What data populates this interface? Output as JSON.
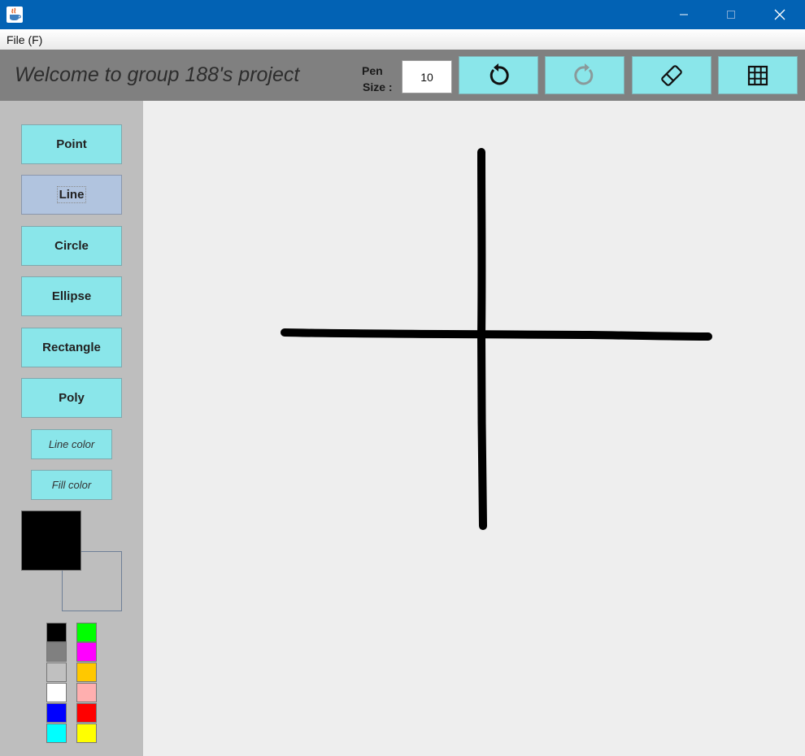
{
  "menu": {
    "file_label": "File (F)"
  },
  "toolbar": {
    "welcome_text": "Welcome to group 188's project",
    "pen_label_line1": "Pen",
    "pen_label_line2": "Size :",
    "pen_size_value": "10",
    "buttons": [
      "undo-icon",
      "redo-icon",
      "eraser-icon",
      "grid-icon"
    ],
    "redo_enabled": false
  },
  "sidebar": {
    "shape_buttons": [
      {
        "label": "Point",
        "selected": false
      },
      {
        "label": "Line",
        "selected": true
      },
      {
        "label": "Circle",
        "selected": false
      },
      {
        "label": "Ellipse",
        "selected": false
      },
      {
        "label": "Rectangle",
        "selected": false
      },
      {
        "label": "Poly",
        "selected": false
      }
    ],
    "line_color_label": "Line color",
    "fill_color_label": "Fill color",
    "current_line_color": "#000000",
    "current_fill_color": "transparent",
    "palette_left": [
      "#000000",
      "#808080",
      "#c0c0c0",
      "#ffffff",
      "#0000ff",
      "#00ffff"
    ],
    "palette_right": [
      "#00ff00",
      "#ff00ff",
      "#ffc800",
      "#ffafaf",
      "#ff0000",
      "#ffff00"
    ]
  },
  "canvas": {
    "stroke_color": "#000000",
    "strokes": [
      "horizontal-line",
      "vertical-line"
    ]
  },
  "colors": {
    "titlebar": "#0262b4",
    "button_bg": "#8ae6ea",
    "button_selected": "#b1c4df",
    "toolbar_bg": "#808080",
    "sidebar_bg": "#bebebe",
    "canvas_bg": "#eeeeee"
  }
}
